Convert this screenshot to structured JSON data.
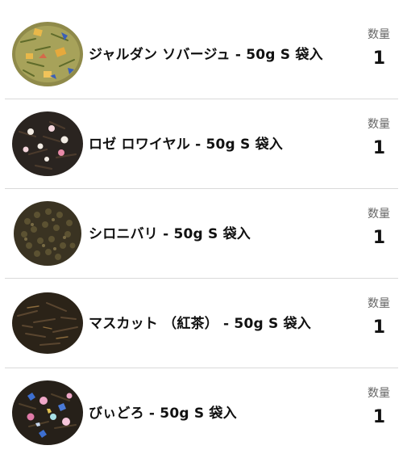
{
  "colors": {
    "divider": "#d9d9d9",
    "text": "#111111",
    "qty_label": "#666666"
  },
  "cart": {
    "items": [
      {
        "name": "ジャルダン ソバージュ - 50g S 袋入",
        "qty_label": "数量",
        "qty": "1",
        "thumb": "tea-leaves-green-blend"
      },
      {
        "name": "ロゼ ロワイヤル - 50g S 袋入",
        "qty_label": "数量",
        "qty": "1",
        "thumb": "tea-leaves-black-with-pearls"
      },
      {
        "name": "シロニバリ - 50g S 袋入",
        "qty_label": "数量",
        "qty": "1",
        "thumb": "tea-leaves-rolled-pellets"
      },
      {
        "name": "マスカット （紅茶） - 50g S 袋入",
        "qty_label": "数量",
        "qty": "1",
        "thumb": "tea-leaves-black"
      },
      {
        "name": "びぃどろ - 50g S 袋入",
        "qty_label": "数量",
        "qty": "1",
        "thumb": "tea-leaves-black-with-petals"
      }
    ]
  }
}
